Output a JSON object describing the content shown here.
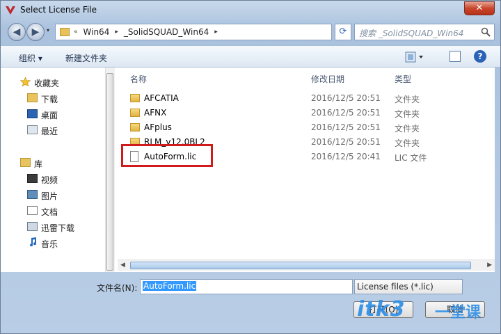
{
  "window": {
    "title": "Select License File",
    "close_label": "✕"
  },
  "nav": {
    "back": "◀",
    "forward": "▶",
    "dropdown": "▾",
    "address": [
      "«",
      "Win64",
      "▸",
      "_SolidSQUAD_Win64",
      "▸"
    ],
    "refresh": "⟳",
    "search_placeholder": "搜索 _SolidSQUAD_Win64"
  },
  "toolbar": {
    "organize": "组织 ▾",
    "new_folder": "新建文件夹",
    "help": "?"
  },
  "navpane": {
    "favorites": {
      "label": "收藏夹",
      "items": [
        "下载",
        "桌面",
        "最近"
      ]
    },
    "library": {
      "label": "库",
      "items": [
        "视频",
        "图片",
        "文档",
        "迅雷下载",
        "音乐"
      ]
    }
  },
  "columns": {
    "name": "名称",
    "date": "修改日期",
    "type": "类型"
  },
  "files": [
    {
      "name": "AFCATIA",
      "date": "2016/12/5 20:51",
      "type": "文件夹",
      "kind": "folder"
    },
    {
      "name": "AFNX",
      "date": "2016/12/5 20:51",
      "type": "文件夹",
      "kind": "folder"
    },
    {
      "name": "AFplus",
      "date": "2016/12/5 20:51",
      "type": "文件夹",
      "kind": "folder"
    },
    {
      "name": "RLM_v12.0BL2",
      "date": "2016/12/5 20:51",
      "type": "文件夹",
      "kind": "folder"
    },
    {
      "name": "AutoForm.lic",
      "date": "2016/12/5 20:41",
      "type": "LIC 文件",
      "kind": "file"
    }
  ],
  "bottom": {
    "filename_label": "文件名(N):",
    "filename_value": "AutoForm.lic",
    "filter": "License files (*.lic)",
    "open_label": "打开(O)",
    "cancel_label": "取消"
  },
  "watermark": {
    "brand": "itk3",
    "suffix": "一堂课"
  },
  "colors": {
    "highlight": "#d11a1a",
    "selection": "#3399ff",
    "watermark": "#2f8fe6"
  }
}
